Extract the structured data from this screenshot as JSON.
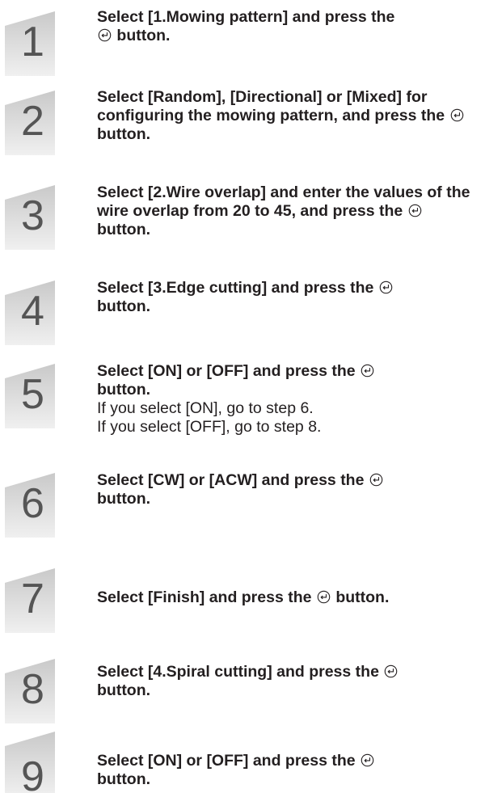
{
  "steps": [
    {
      "number": "1",
      "segments": [
        "Select [1.Mowing pattern] and press the",
        "button."
      ],
      "notes": []
    },
    {
      "number": "2",
      "segments": [
        "Select [Random], [Directional] or [Mixed] for configuring the mowing pattern, and press the",
        "button."
      ],
      "notes": []
    },
    {
      "number": "3",
      "segments": [
        "Select [2.Wire overlap] and enter the values of the wire overlap from 20 to 45, and press the",
        "button."
      ],
      "notes": []
    },
    {
      "number": "4",
      "segments": [
        "Select [3.Edge cutting] and press the",
        "button."
      ],
      "notes": []
    },
    {
      "number": "5",
      "segments": [
        "Select [ON] or [OFF] and press the",
        "button."
      ],
      "notes": [
        "If you select [ON], go to step 6.",
        "If you select [OFF], go to step 8."
      ]
    },
    {
      "number": "6",
      "segments": [
        "Select [CW] or [ACW] and press the",
        "button."
      ],
      "notes": []
    },
    {
      "number": "7",
      "segments": [
        "Select [Finish] and press the",
        "button."
      ],
      "notes": []
    },
    {
      "number": "8",
      "segments": [
        "Select [4.Spiral cutting] and press the",
        "button."
      ],
      "notes": []
    },
    {
      "number": "9",
      "segments": [
        "Select [ON] or [OFF] and press the",
        "button."
      ],
      "notes": []
    }
  ],
  "icons": {
    "enter": "enter-button-icon"
  },
  "colors": {
    "text": "#231f20",
    "number_badge": "#d9d9d9",
    "number_text": "#555555"
  }
}
